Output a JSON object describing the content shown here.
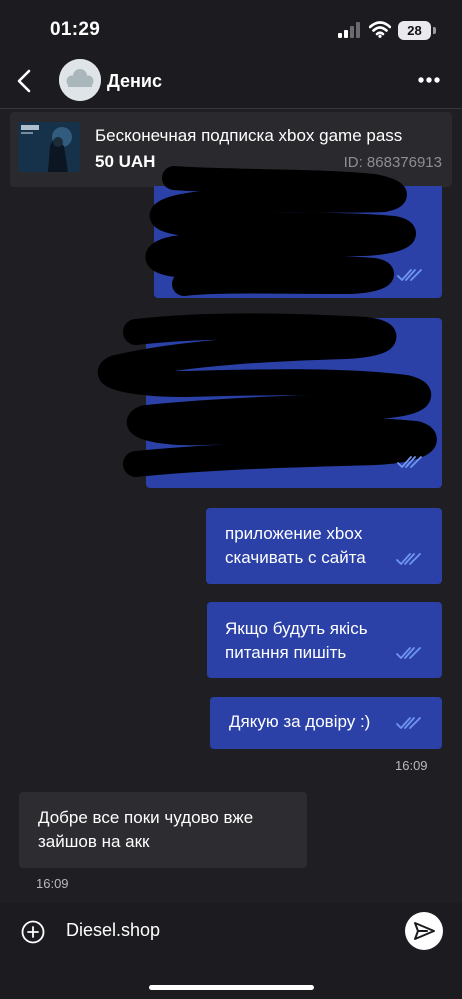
{
  "status": {
    "time": "01:29",
    "battery": "28"
  },
  "chat": {
    "contact_name": "Денис"
  },
  "product": {
    "title": "Бесконечная подписка xbox game pass",
    "price": "50 UAH",
    "id": "ID: 868376913"
  },
  "messages": [
    {
      "text": "",
      "direction": "out",
      "redacted": true
    },
    {
      "text": "",
      "direction": "out",
      "redacted": true
    },
    {
      "lines": [
        "приложение xbox",
        "скачивать с сайта"
      ],
      "direction": "out",
      "read": true
    },
    {
      "lines": [
        "Якщо будуть якісь",
        "питання пишіть"
      ],
      "direction": "out",
      "read": true
    },
    {
      "lines": [
        "Дякую за довіру :)"
      ],
      "direction": "out",
      "read": true,
      "time": "16:09"
    },
    {
      "lines": [
        "Добре все поки чудово вже",
        "зайшов на акк"
      ],
      "direction": "in",
      "time": "16:09"
    }
  ],
  "composer": {
    "text": "Diesel.shop"
  },
  "colors": {
    "outgoing_bubble": "#2b41a8",
    "incoming_bubble": "#2c2c31",
    "background": "#1f1f23",
    "tick": "#6f95ee"
  },
  "icons": [
    "back-arrow-icon",
    "more-dots-icon",
    "double-check-icon",
    "add-circle-icon",
    "send-icon",
    "signal-icon",
    "wifi-icon",
    "battery-icon"
  ]
}
